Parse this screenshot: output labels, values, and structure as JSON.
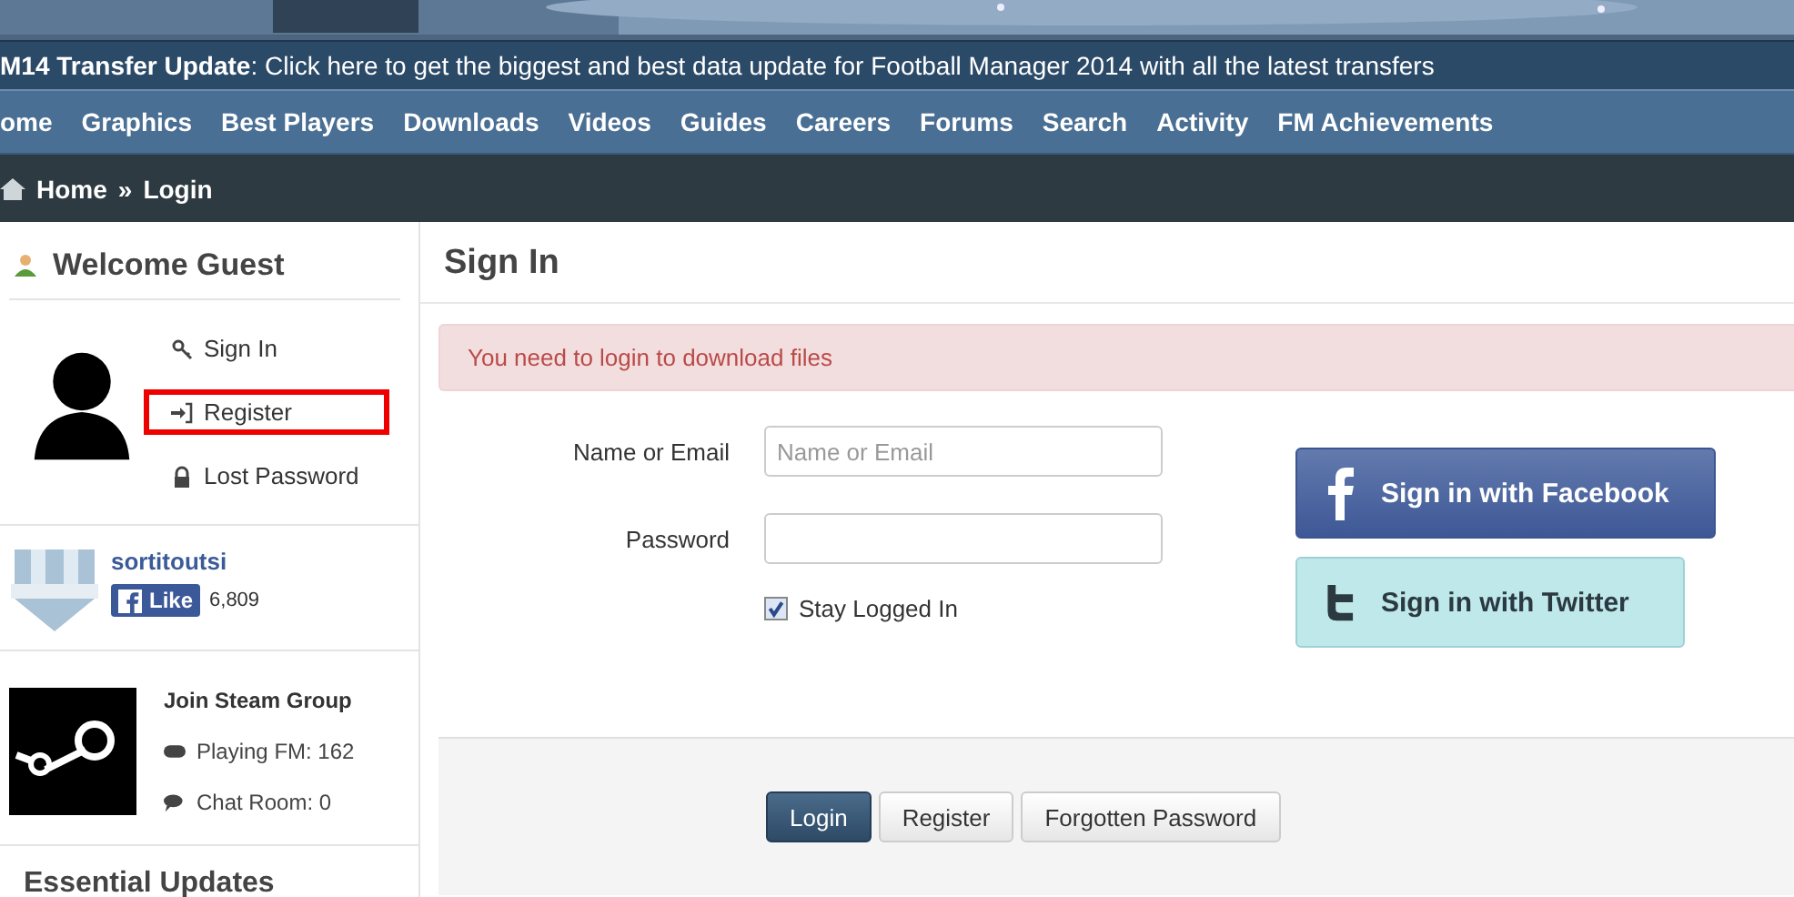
{
  "banner": {
    "kind": "picture"
  },
  "announcement": {
    "title": "M14 Transfer Update",
    "text": ": Click here to get the biggest and best data update for Football Manager 2014 with all the latest transfers"
  },
  "nav": [
    "ome",
    "Graphics",
    "Best Players",
    "Downloads",
    "Videos",
    "Guides",
    "Careers",
    "Forums",
    "Search",
    "Activity",
    "FM Achievements"
  ],
  "breadcrumb": [
    "Home",
    "Login"
  ],
  "breadcrumb_separator": "»",
  "sidebar": {
    "title": "Welcome Guest",
    "links": [
      {
        "label": "Sign In",
        "kind": "key",
        "highlighted": false
      },
      {
        "label": "Register",
        "kind": "enter",
        "highlighted": true
      },
      {
        "label": "Lost Password",
        "kind": "lock",
        "highlighted": false
      }
    ],
    "facebook": {
      "name": "sortitoutsi",
      "like": "Like",
      "count": "6,809"
    },
    "steam": {
      "title": "Join Steam Group",
      "playing": "Playing FM: 162",
      "chat": "Chat Room: 0"
    },
    "section_title": "Essential Updates"
  },
  "main": {
    "title": "Sign In",
    "alert": "You need to login to download files",
    "fields": [
      {
        "label": "Name or Email",
        "placeholder": "Name or Email"
      },
      {
        "label": "Password"
      }
    ],
    "stay_logged_in": {
      "label": "Stay Logged In",
      "checked": true
    },
    "social": [
      {
        "kind": "facebook",
        "label": "Sign in with Facebook"
      },
      {
        "kind": "twitter",
        "label": "Sign in with Twitter"
      }
    ],
    "buttons": [
      {
        "kind": "primary",
        "label": "Login"
      },
      {
        "kind": "default",
        "label": "Register"
      },
      {
        "kind": "default",
        "label": "Forgotten Password"
      }
    ]
  }
}
